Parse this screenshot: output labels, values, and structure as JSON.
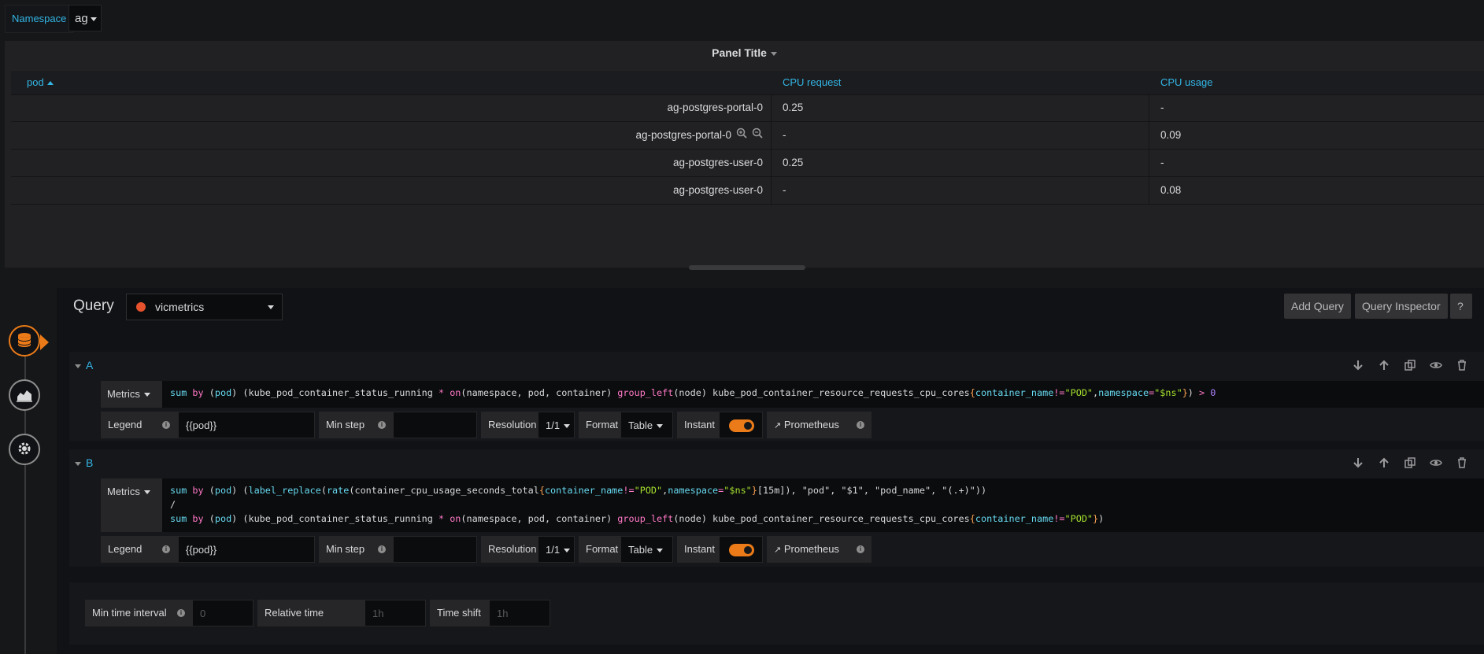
{
  "variables": {
    "namespace_label": "Namespace",
    "namespace_value": "ag"
  },
  "panel": {
    "title": "Panel Title",
    "columns": [
      "pod",
      "CPU request",
      "CPU usage"
    ],
    "rows": [
      {
        "pod": "ag-postgres-portal-0",
        "cpu_request": "0.25",
        "cpu_usage": "-"
      },
      {
        "pod": "ag-postgres-portal-0",
        "cpu_request": "-",
        "cpu_usage": "0.09"
      },
      {
        "pod": "ag-postgres-user-0",
        "cpu_request": "0.25",
        "cpu_usage": "-"
      },
      {
        "pod": "ag-postgres-user-0",
        "cpu_request": "-",
        "cpu_usage": "0.08"
      }
    ]
  },
  "editor": {
    "title": "Query",
    "datasource": "vicmetrics",
    "add_query": "Add Query",
    "query_inspector": "Query Inspector",
    "help": "?"
  },
  "queries": [
    {
      "ref": "A",
      "type_label": "Metrics",
      "legend_label": "Legend",
      "legend_value": "{{pod}}",
      "min_step_label": "Min step",
      "min_step_value": "",
      "resolution_label": "Resolution",
      "resolution_value": "1/1",
      "format_label": "Format",
      "format_value": "Table",
      "instant_label": "Instant",
      "prometheus_label": "Prometheus"
    },
    {
      "ref": "B",
      "type_label": "Metrics",
      "legend_label": "Legend",
      "legend_value": "{{pod}}",
      "min_step_label": "Min step",
      "min_step_value": "",
      "resolution_label": "Resolution",
      "resolution_value": "1/1",
      "format_label": "Format",
      "format_value": "Table",
      "instant_label": "Instant",
      "prometheus_label": "Prometheus"
    }
  ],
  "query_options": {
    "min_interval_label": "Min time interval",
    "min_interval_placeholder": "0",
    "relative_time_label": "Relative time",
    "relative_time_placeholder": "1h",
    "time_shift_label": "Time shift",
    "time_shift_placeholder": "1h"
  },
  "colors": {
    "accent": "#33b5e5",
    "orange": "#eb7b18",
    "background": "#161719"
  }
}
